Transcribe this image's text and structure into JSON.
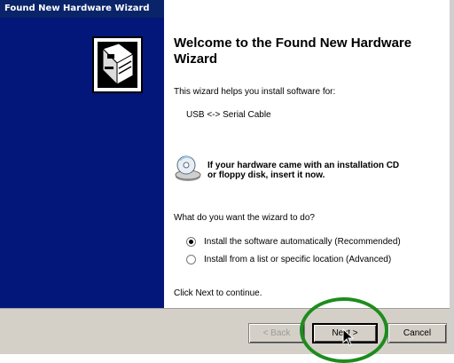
{
  "window": {
    "title": "Found New Hardware Wizard"
  },
  "content": {
    "heading": "Welcome to the Found New Hardware Wizard",
    "intro": "This wizard helps you install software for:",
    "device": "USB <-> Serial Cable",
    "cd_note_line1": "If your hardware came with an installation CD",
    "cd_note_line2": "or floppy disk, insert it now.",
    "question": "What do you want the wizard to do?",
    "options": [
      {
        "label": "Install the software automatically (Recommended)",
        "selected": true
      },
      {
        "label": "Install from a list or specific location (Advanced)",
        "selected": false
      }
    ],
    "footer": "Click Next to continue."
  },
  "buttons": {
    "back": "< Back",
    "next": "Next >",
    "cancel": "Cancel"
  },
  "icons": {
    "logo": "hardware-card-icon",
    "cd": "cd-floppy-icon",
    "cursor": "mouse-pointer-icon"
  },
  "colors": {
    "sidebar": "#03167a",
    "titlebar": "#0a246a",
    "highlight": "#1e8c1e",
    "button_face": "#d4d0c8"
  }
}
